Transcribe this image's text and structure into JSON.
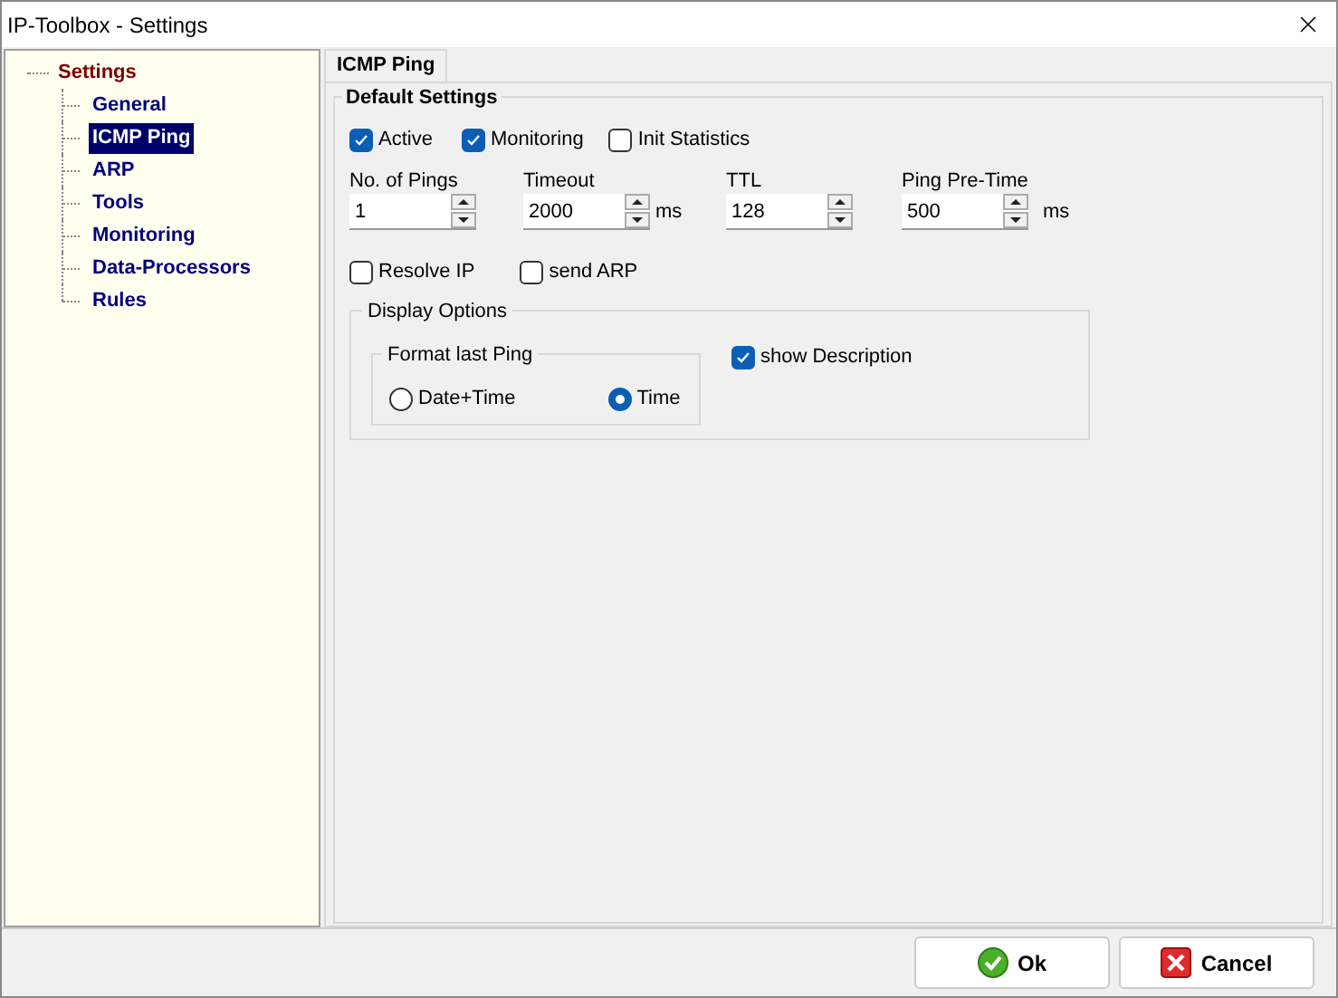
{
  "window": {
    "title": "IP-Toolbox - Settings"
  },
  "tree": {
    "label": "Settings",
    "children": [
      {
        "label": "General",
        "selected": false
      },
      {
        "label": "ICMP Ping",
        "selected": true
      },
      {
        "label": "ARP",
        "selected": false
      },
      {
        "label": "Tools",
        "selected": false
      },
      {
        "label": "Monitoring",
        "selected": false
      },
      {
        "label": "Data-Processors",
        "selected": false
      },
      {
        "label": "Rules",
        "selected": false
      }
    ]
  },
  "tabs": [
    {
      "label": "ICMP Ping",
      "selected": true
    }
  ],
  "default_settings": {
    "title": "Default Settings",
    "options": [
      {
        "label": "Active",
        "checked": true
      },
      {
        "label": "Monitoring",
        "checked": true
      },
      {
        "label": "Init Statistics",
        "checked": false
      }
    ],
    "spinners": [
      {
        "label": "No. of Pings",
        "value": "1"
      },
      {
        "label": "Timeout",
        "value": "2000",
        "unit": "ms"
      },
      {
        "label": "TTL",
        "value": "128"
      },
      {
        "label": "Ping Pre-Time",
        "value": "500",
        "unit": "ms"
      }
    ],
    "options2": [
      {
        "label": "Resolve IP",
        "checked": false
      },
      {
        "label": "send ARP",
        "checked": false
      }
    ],
    "display_options": {
      "title": "Display Options",
      "format_group": {
        "title": "Format last Ping",
        "radios": [
          {
            "label": "Date+Time",
            "selected": false
          },
          {
            "label": "Time",
            "selected": true
          }
        ]
      },
      "show_description": {
        "label": "show Description",
        "checked": true
      }
    }
  },
  "buttons": [
    {
      "label": "Ok",
      "kind": "ok"
    },
    {
      "label": "Cancel",
      "kind": "cancel"
    }
  ]
}
